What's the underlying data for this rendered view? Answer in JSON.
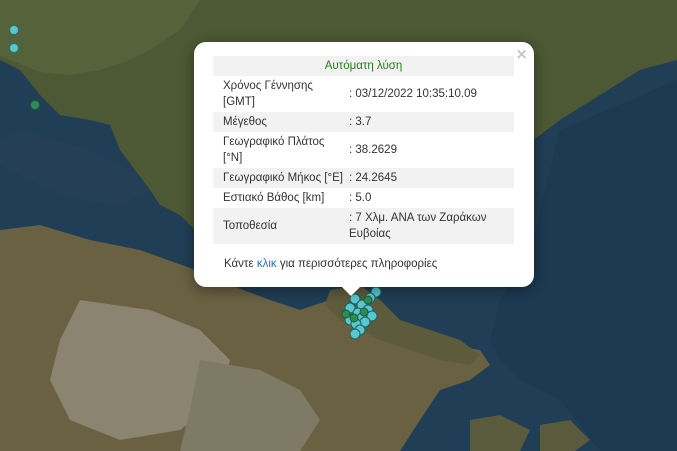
{
  "popup": {
    "title": "Αυτόματη λύση",
    "close_glyph": "×",
    "rows": [
      {
        "label": "Χρόνος Γέννησης [GMT]",
        "value": ": 03/12/2022 10:35:10.09"
      },
      {
        "label": "Μέγεθος",
        "value": ": 3.7"
      },
      {
        "label": "Γεωγραφικό Πλάτος [°N]",
        "value": ": 38.2629"
      },
      {
        "label": "Γεωγραφικό Μήκος [°E]",
        "value": ": 24.2645"
      },
      {
        "label": "Εστιακό Βάθος [km]",
        "value": ": 5.0"
      },
      {
        "label": "Τοποθεσία",
        "value": ": 7 Χλμ. ΑΝΑ των Ζαράκων Ευβοίας"
      }
    ],
    "more_prefix": "Κάντε",
    "more_link": "κλικ",
    "more_suffix": "για περισσότερες πληροφορίες"
  },
  "colors": {
    "sea": "#1f3d55",
    "land": "#4f5b34",
    "quake_marker": "#55c9cf",
    "quake_marker_old": "#2e8b57",
    "title_green": "#2a7a1f",
    "link_blue": "#1a7ab5"
  },
  "markers": {
    "cluster_count_visible": 18
  }
}
